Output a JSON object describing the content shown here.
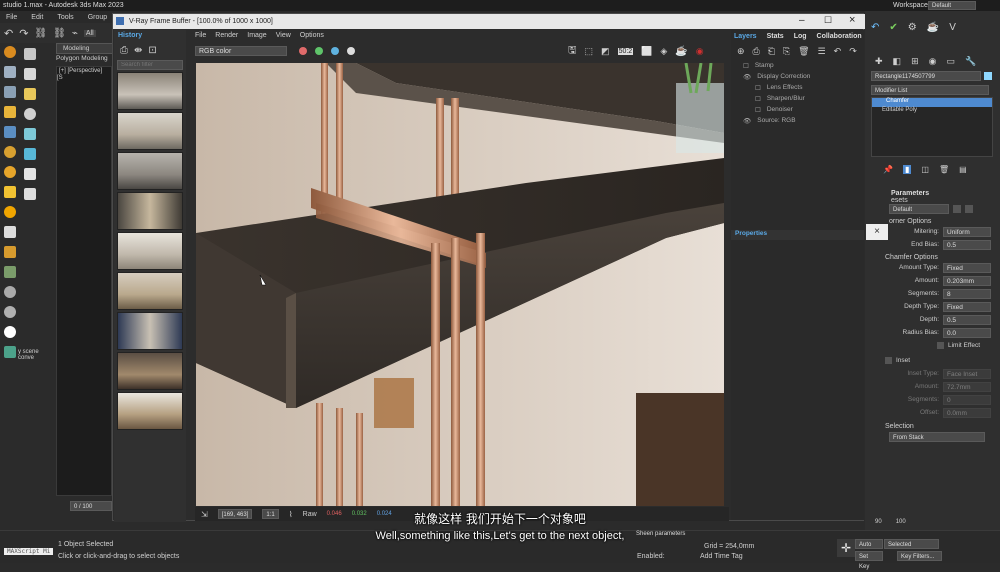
{
  "app": {
    "title": "studio 1.max - Autodesk 3ds Max 2023",
    "workspaces_label": "Workspaces:",
    "workspace_value": "Default"
  },
  "menu": [
    "File",
    "Edit",
    "Tools",
    "Group"
  ],
  "ribbon": {
    "modeling": "Modeling",
    "polygon": "Polygon Modeling"
  },
  "viewport": {
    "label": "[+] [Perspective] [S"
  },
  "left_scene_label": "y scene conve",
  "timeline": {
    "frame": "0 / 100"
  },
  "status": {
    "objects": "1 Object Selected",
    "hint": "Click or click-and-drag to select objects",
    "maxscript": "MAXScript Mi",
    "grid": "Grid = 254,0mm",
    "enabled": "Enabled:",
    "add_time_tag": "Add Time Tag",
    "autokey": "Auto Key",
    "selected": "Selected",
    "setkey": "Set Key",
    "keyfilters": "Key Filters..."
  },
  "vfb": {
    "title": "V-Ray Frame Buffer - [100.0% of 1000 x 1000]",
    "history_title": "History",
    "search_placeholder": "Search filter",
    "menu": [
      "File",
      "Render",
      "Image",
      "View",
      "Options"
    ],
    "channel": "RGB color",
    "coords": "[169, 463]",
    "zoom": "1:1",
    "raw": "Raw",
    "r": "0.046",
    "g": "0.032",
    "b": "0.024"
  },
  "layers_panel": {
    "tabs": [
      "Layers",
      "Stats",
      "Log",
      "Collaboration"
    ],
    "items": [
      "Stamp",
      "Display Correction",
      "Lens Effects",
      "Sharpen/Blur",
      "Denoiser",
      "Source: RGB"
    ],
    "properties": "Properties"
  },
  "cmd": {
    "object_name": "Rectangle1174507799",
    "modifier_list": "Modifier List",
    "stack": [
      "Chamfer",
      "Editable Poly"
    ],
    "params_title": "Parameters",
    "presets": "esets",
    "preset_value": "Default",
    "corner_options": "orner Options",
    "mitering": {
      "label": "Mitering:",
      "value": "Uniform"
    },
    "end_bias": {
      "label": "End Bias:",
      "value": "0.5"
    },
    "chamfer_options": "Chamfer Options",
    "amount_type": {
      "label": "Amount Type:",
      "value": "Fixed"
    },
    "amount": {
      "label": "Amount:",
      "value": "0.203mm"
    },
    "segments": {
      "label": "Segments:",
      "value": "8"
    },
    "depth_type": {
      "label": "Depth Type:",
      "value": "Fixed"
    },
    "depth": {
      "label": "Depth:",
      "value": "0.5"
    },
    "radius_bias": {
      "label": "Radius Bias:",
      "value": "0.0"
    },
    "limit_effect": "Limit Effect",
    "inset": "Inset",
    "inset_type": {
      "label": "Inset Type:",
      "value": "Face Inset"
    },
    "inset_amount": {
      "label": "Amount:",
      "value": "72.7mm"
    },
    "inset_segments": {
      "label": "Segments:",
      "value": "0"
    },
    "inset_offset": {
      "label": "Offset:",
      "value": "0.0mm"
    },
    "selection": "Selection",
    "from_stack": "From Stack",
    "sheen": "Sheen parameters",
    "ruler": [
      "90",
      "100"
    ]
  },
  "subtitles": {
    "zh": "就像这样 我们开始下一个对象吧",
    "en": "Well,something like this,Let's get to the next object,"
  }
}
